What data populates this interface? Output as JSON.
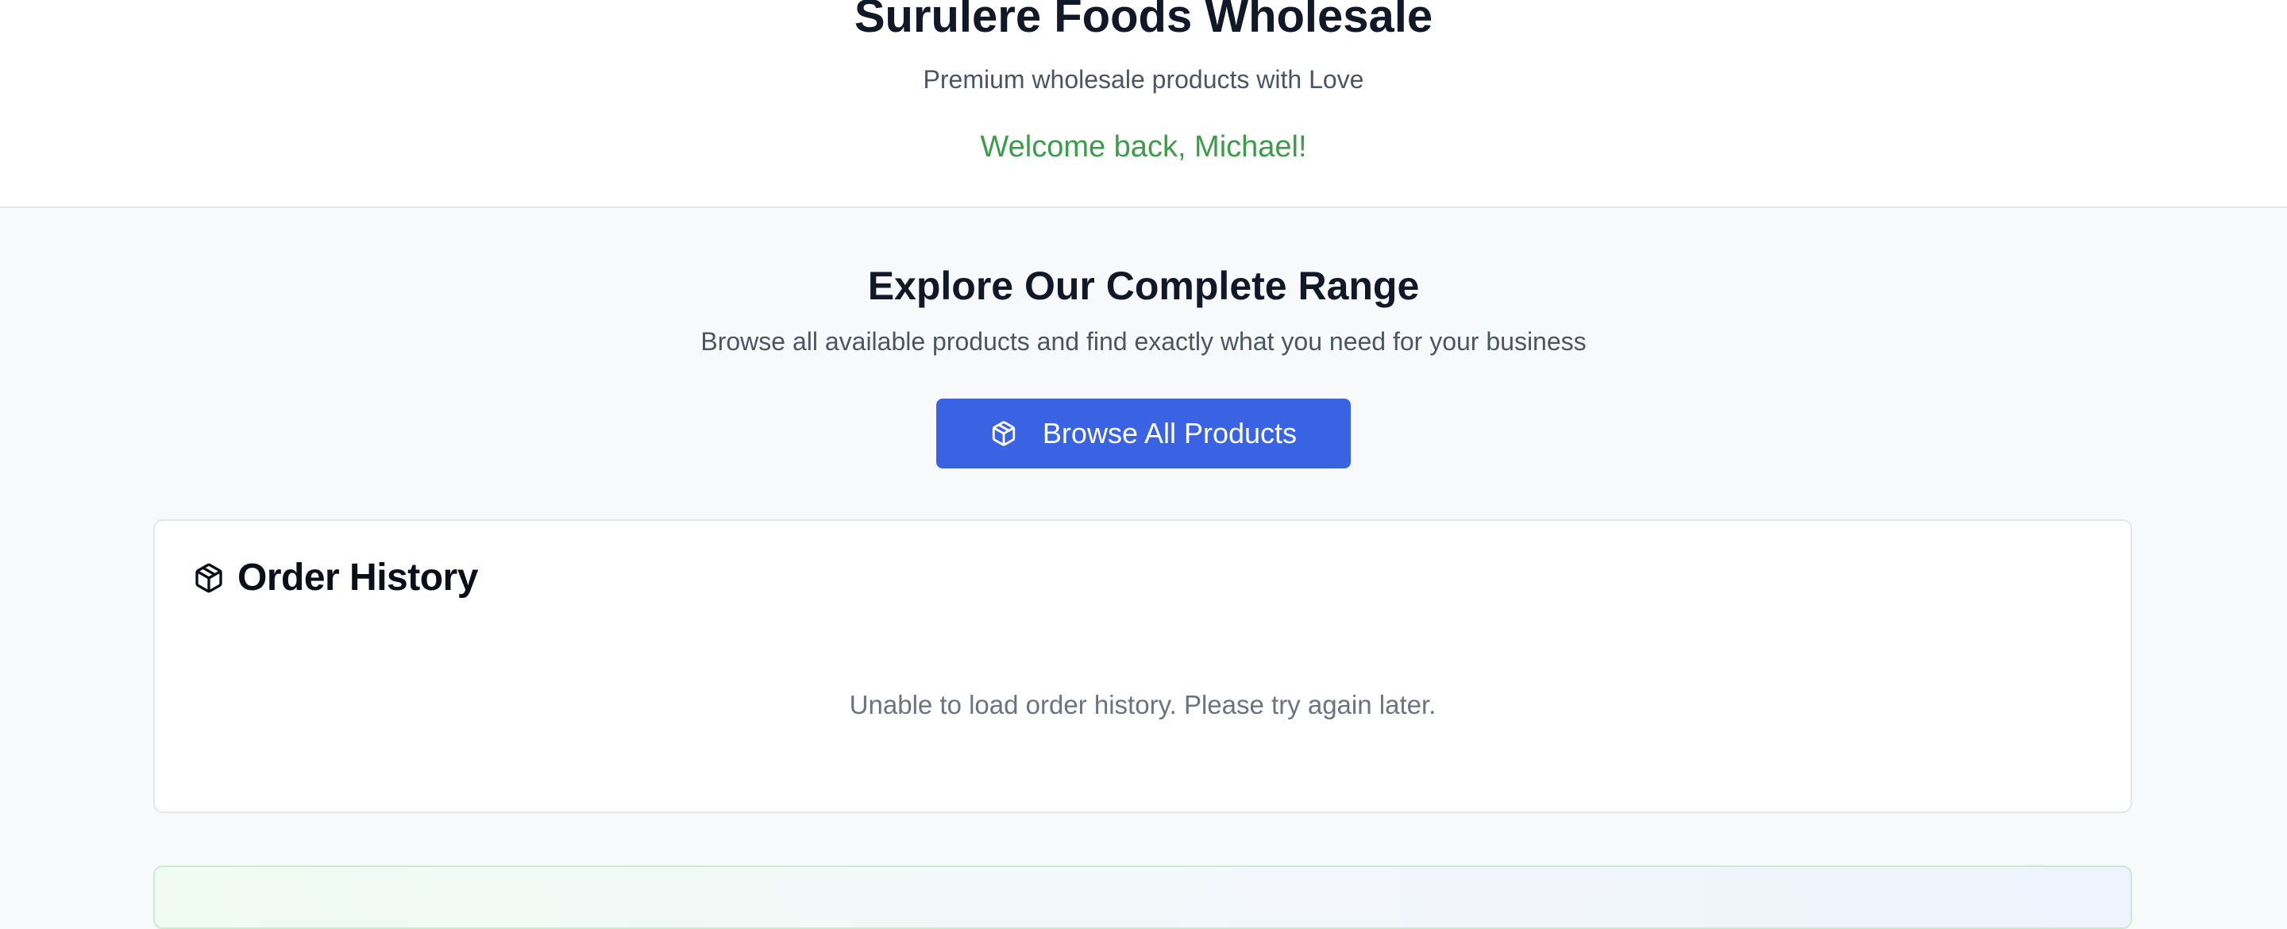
{
  "header": {
    "title": "Surulere Foods Wholesale",
    "tagline": "Premium wholesale products with Love",
    "welcome": "Welcome back, Michael!"
  },
  "explore": {
    "title": "Explore Our Complete Range",
    "subtitle": "Browse all available products and find exactly what you need for your business",
    "button_label": "Browse All Products",
    "button_icon": "package-icon"
  },
  "order_history": {
    "title": "Order History",
    "icon": "package-icon",
    "error_message": "Unable to load order history. Please try again later."
  },
  "colors": {
    "primary": "#3a63e3",
    "welcome_green": "#3b9c4a",
    "heading": "#111827",
    "muted": "#6b7280",
    "background": "#f8f9fb"
  }
}
